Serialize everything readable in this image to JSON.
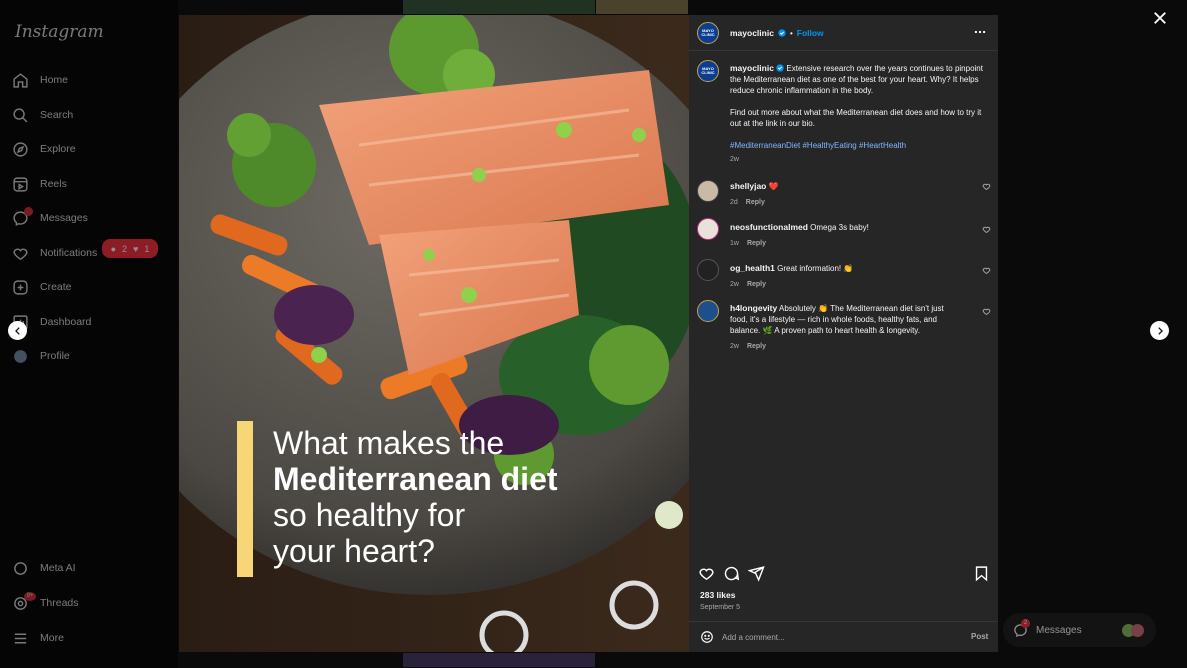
{
  "app": {
    "logo": "Instagram"
  },
  "sidebar": {
    "items": [
      {
        "label": "Home",
        "icon": "home-icon"
      },
      {
        "label": "Search",
        "icon": "search-icon"
      },
      {
        "label": "Explore",
        "icon": "compass-icon"
      },
      {
        "label": "Reels",
        "icon": "reels-icon"
      },
      {
        "label": "Messages",
        "icon": "messenger-icon"
      },
      {
        "label": "Notifications",
        "icon": "heart-icon"
      },
      {
        "label": "Create",
        "icon": "plus-square-icon"
      },
      {
        "label": "Dashboard",
        "icon": "dashboard-icon"
      },
      {
        "label": "Profile",
        "icon": "avatar"
      }
    ],
    "bottom": [
      {
        "label": "Meta AI",
        "icon": "meta-ai-icon"
      },
      {
        "label": "Threads",
        "icon": "threads-icon",
        "badge": "9+"
      },
      {
        "label": "More",
        "icon": "menu-icon"
      }
    ],
    "notification_pill": {
      "comments": "2",
      "likes": "1"
    }
  },
  "post": {
    "overlay": {
      "line1": "What makes the",
      "line2": "Mediterranean diet",
      "line3": "so healthy for",
      "line4": "your heart?"
    },
    "accent_color": "#f7d678"
  },
  "panel": {
    "author": "mayoclinic",
    "author_avatar_text": "MAYO CLINIC",
    "follow_label": "Follow",
    "separator": "•",
    "caption": {
      "p1": "Extensive research over the years continues to pinpoint the Mediterranean diet as one of the best for your heart. Why? It helps reduce chronic inflammation in the body.",
      "p2": "Find out more about what the Mediterranean diet does and how to try it out at the link in our bio.",
      "hashtags": "#MediterraneanDiet #HealthyEating #HeartHealth",
      "time": "2w"
    },
    "comments": [
      {
        "user": "shellyjao",
        "text": "❤️",
        "time": "2d",
        "reply": "Reply"
      },
      {
        "user": "neosfunctionalmed",
        "text": "Omega 3s baby!",
        "time": "1w",
        "reply": "Reply"
      },
      {
        "user": "og_health1",
        "text": "Great information! 👏",
        "time": "2w",
        "reply": "Reply"
      },
      {
        "user": "h4longevity",
        "text": "Absolutely 👏 The Mediterranean diet isn't just food, it's a lifestyle — rich in whole foods, healthy fats, and balance. 🌿 A proven path to heart health & longevity.",
        "time": "2w",
        "reply": "Reply"
      }
    ],
    "likes": "283 likes",
    "date": "September 5",
    "add_comment_placeholder": "Add a comment...",
    "post_label": "Post"
  },
  "messages_pill": {
    "label": "Messages",
    "badge": "2"
  },
  "colors": {
    "link": "#0095f6",
    "panel_bg": "#262626",
    "badge": "#ff3040"
  }
}
